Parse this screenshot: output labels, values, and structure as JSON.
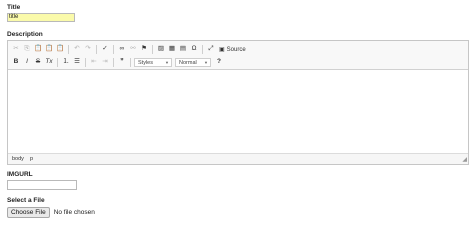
{
  "form": {
    "title_label": "Title",
    "title_value": "title",
    "description_label": "Description",
    "imgurl_label": "IMGURL",
    "imgurl_value": "",
    "file_label": "Select a File",
    "file_button": "Choose File",
    "file_status": "No file chosen"
  },
  "editor": {
    "toolbar_row1": [
      {
        "name": "cut-icon",
        "glyph": "✂",
        "dim": true
      },
      {
        "name": "copy-icon",
        "glyph": "⎘",
        "dim": true
      },
      {
        "name": "paste-icon",
        "glyph": "📋",
        "dim": false
      },
      {
        "name": "paste-text-icon",
        "glyph": "📋",
        "dim": false
      },
      {
        "name": "paste-word-icon",
        "glyph": "📋",
        "dim": false
      },
      {
        "sep": true
      },
      {
        "name": "undo-icon",
        "glyph": "↶",
        "dim": true
      },
      {
        "name": "redo-icon",
        "glyph": "↷",
        "dim": true
      },
      {
        "sep": true
      },
      {
        "name": "spellcheck-icon",
        "glyph": "✓",
        "dim": false
      },
      {
        "sep": true
      },
      {
        "name": "link-icon",
        "glyph": "∞",
        "dim": false
      },
      {
        "name": "unlink-icon",
        "glyph": "⚯",
        "dim": true
      },
      {
        "name": "anchor-icon",
        "glyph": "⚑",
        "dim": false
      },
      {
        "sep": true
      },
      {
        "name": "image-icon",
        "glyph": "▨",
        "dim": false
      },
      {
        "name": "table-icon",
        "glyph": "▦",
        "dim": false
      },
      {
        "name": "horizontal-line-icon",
        "glyph": "▤",
        "dim": false
      },
      {
        "name": "special-char-icon",
        "glyph": "Ω",
        "dim": false
      },
      {
        "sep": true
      },
      {
        "name": "maximize-icon",
        "glyph": "⤢",
        "dim": false
      }
    ],
    "source_label": "Source",
    "toolbar_row2": [
      {
        "name": "bold-icon",
        "glyph": "B",
        "dim": false,
        "style": "bold"
      },
      {
        "name": "italic-icon",
        "glyph": "I",
        "dim": false,
        "style": "italic"
      },
      {
        "name": "strike-icon",
        "glyph": "S",
        "dim": false,
        "style": "strike"
      },
      {
        "name": "remove-format-icon",
        "glyph": "Tx",
        "dim": false,
        "style": "italic"
      },
      {
        "sep": true
      },
      {
        "name": "numbered-list-icon",
        "glyph": "⒈",
        "dim": false
      },
      {
        "name": "bulleted-list-icon",
        "glyph": "☰",
        "dim": false
      },
      {
        "sep": true
      },
      {
        "name": "outdent-icon",
        "glyph": "⇤",
        "dim": true
      },
      {
        "name": "indent-icon",
        "glyph": "⇥",
        "dim": true
      },
      {
        "sep": true
      },
      {
        "name": "blockquote-icon",
        "glyph": "❞",
        "dim": false
      },
      {
        "sep": true
      }
    ],
    "styles_combo": "Styles",
    "format_combo": "Normal",
    "help_glyph": "?",
    "status_path": [
      "body",
      "p"
    ]
  }
}
